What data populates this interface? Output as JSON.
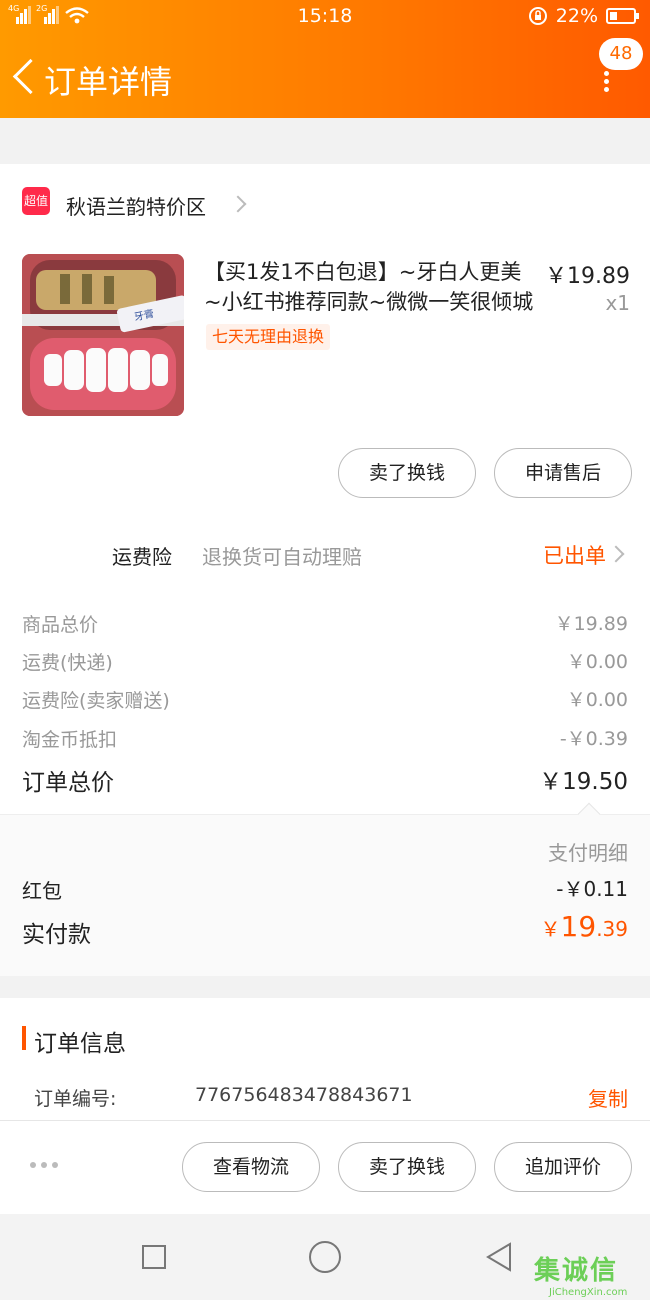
{
  "status_bar": {
    "net_4g": "4G",
    "net_2g": "2G",
    "time": "15:18",
    "battery": "22%"
  },
  "header": {
    "title": "订单详情",
    "badge": "48"
  },
  "store": {
    "logo_text": "超值",
    "name": "秋语兰韵特价区"
  },
  "product": {
    "title": "【买1发1不白包退】~牙白人更美~小红书推荐同款~微微一笑很倾城",
    "price": "￥19.89",
    "qty": "x1",
    "tag": "七天无理由退换",
    "tube_label": "牙膏"
  },
  "item_actions": {
    "sell": "卖了换钱",
    "aftersale": "申请售后"
  },
  "insurance": {
    "label": "运费险",
    "desc": "退换货可自动理赔",
    "status": "已出单"
  },
  "price_rows": [
    {
      "label": "商品总价",
      "value": "￥19.89"
    },
    {
      "label": "运费(快递)",
      "value": "￥0.00"
    },
    {
      "label": "运费险(卖家赠送)",
      "value": "￥0.00"
    },
    {
      "label": "淘金币抵扣",
      "value": "-￥0.39"
    }
  ],
  "order_total": {
    "label": "订单总价",
    "value": "￥19.50"
  },
  "payment": {
    "detail_label": "支付明细",
    "redpacket_label": "红包",
    "redpacket_value": "-￥0.11",
    "paid_label": "实付款",
    "paid_currency": "￥",
    "paid_int": "19",
    "paid_dec": ".39",
    "accent": "#ff5500"
  },
  "order_info": {
    "section_title": "订单信息",
    "number_label": "订单编号:",
    "number": "776756483478843671",
    "copy": "复制"
  },
  "bottom_actions": {
    "logistics": "查看物流",
    "sell": "卖了换钱",
    "review": "追加评价"
  },
  "watermark": {
    "text": "集诚信",
    "sub": "JiChengXin.com"
  }
}
